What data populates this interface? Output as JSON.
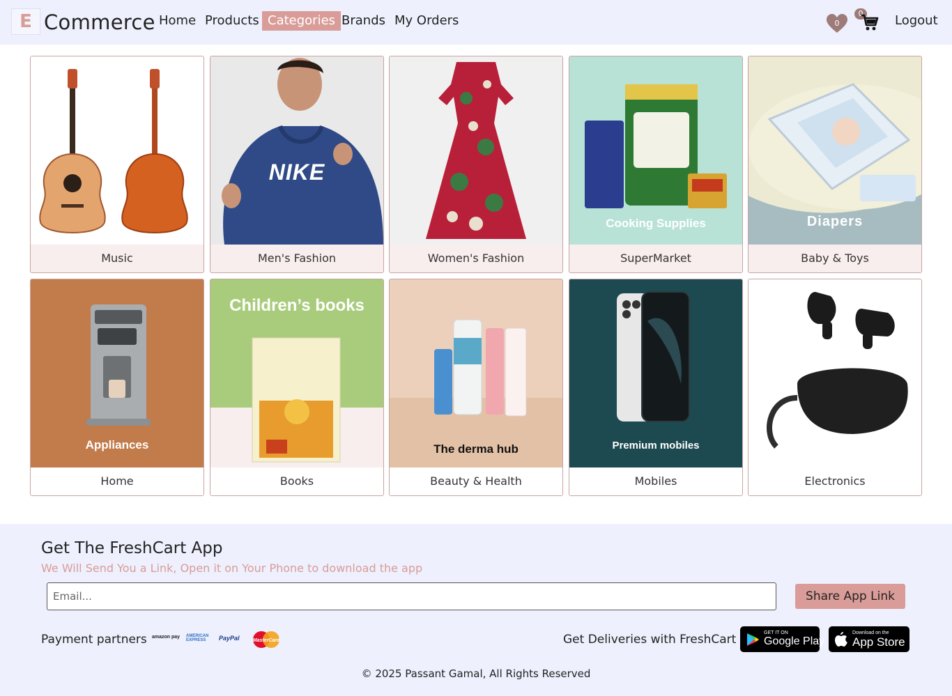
{
  "brand": {
    "logo_letter": "E",
    "name": "Commerce"
  },
  "nav": {
    "links": [
      "Home",
      "Products",
      "Categories",
      "Brands",
      "My Orders"
    ],
    "wishlist_count": "0",
    "cart_count": "0",
    "logout": "Logout"
  },
  "categories": [
    {
      "name": "Music",
      "image_label": ""
    },
    {
      "name": "Men's Fashion",
      "image_label": "NIKE"
    },
    {
      "name": "Women's Fashion",
      "image_label": ""
    },
    {
      "name": "SuperMarket",
      "image_label": "Cooking Supplies"
    },
    {
      "name": "Baby & Toys",
      "image_label": "Diapers"
    },
    {
      "name": "Home",
      "image_label": "Appliances"
    },
    {
      "name": "Books",
      "image_label": "Children’s books"
    },
    {
      "name": "Beauty & Health",
      "image_label": "The derma hub"
    },
    {
      "name": "Mobiles",
      "image_label": "Premium mobiles"
    },
    {
      "name": "Electronics",
      "image_label": ""
    }
  ],
  "footer": {
    "title": "Get The FreshCart App",
    "subtitle": "We Will Send You a Link, Open it on Your Phone to download the app",
    "email_placeholder": "Email...",
    "share_button": "Share App Link",
    "payment_label": "Payment partners",
    "payment_logos": [
      "amazon pay",
      "AMERICAN EXPRESS",
      "PayPal",
      "MasterCard"
    ],
    "deliveries_label": "Get Deliveries with FreshCart",
    "google_play": {
      "small": "GET IT ON",
      "big": "Google Play"
    },
    "app_store": {
      "small": "Download on the",
      "big": "App Store"
    },
    "copyright": "© 2025 Passant Gamal, All Rights Reserved"
  },
  "colors": {
    "accent": "#d99c98",
    "nav_bg": "#eef0fd",
    "card_border": "#c6a4a2"
  }
}
